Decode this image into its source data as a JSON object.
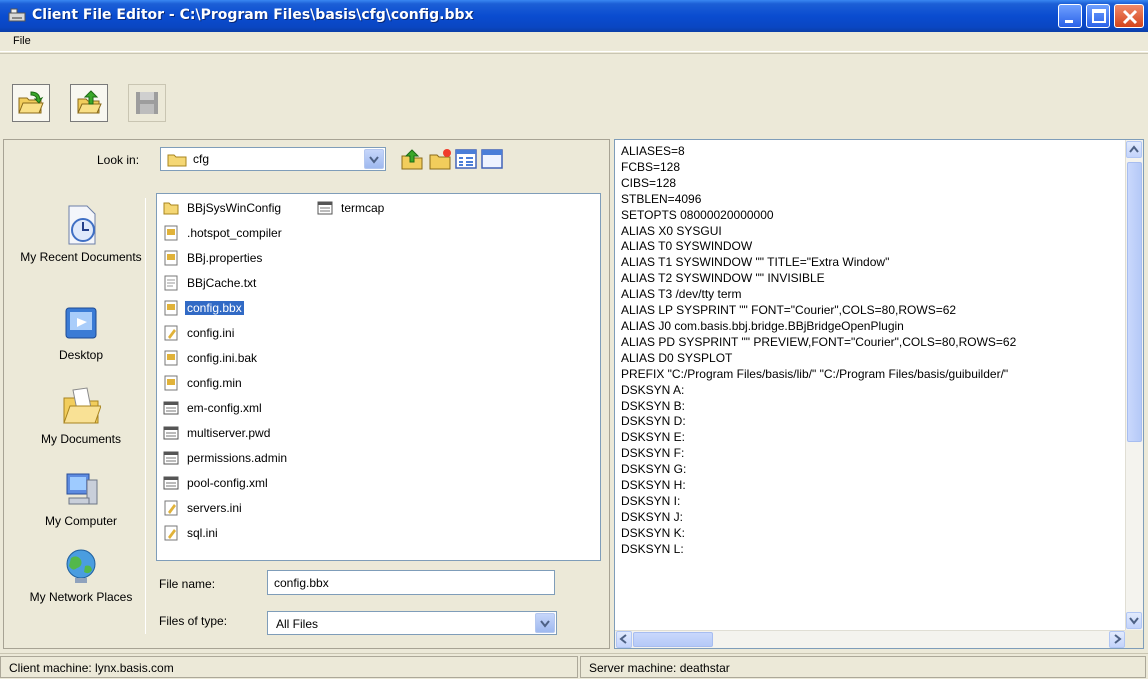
{
  "window": {
    "title": "Client File Editor - C:\\Program Files\\basis\\cfg\\config.bbx"
  },
  "menu": {
    "file_label": "File"
  },
  "toolbar": {
    "buttons": [
      "open-button",
      "open-server-button",
      "save-button"
    ]
  },
  "dialog": {
    "look_in_label": "Look in:",
    "look_in_value": "cfg",
    "places": [
      {
        "label": "My Recent Documents",
        "icon": "recent-documents-icon"
      },
      {
        "label": "Desktop",
        "icon": "desktop-icon"
      },
      {
        "label": "My Documents",
        "icon": "my-documents-icon"
      },
      {
        "label": "My Computer",
        "icon": "my-computer-icon"
      },
      {
        "label": "My Network Places",
        "icon": "network-places-icon"
      }
    ],
    "files": [
      {
        "name": "BBjSysWinConfig",
        "icon": "folder-icon"
      },
      {
        "name": ".hotspot_compiler",
        "icon": "text-file-icon"
      },
      {
        "name": "BBj.properties",
        "icon": "text-file-icon"
      },
      {
        "name": "BBjCache.txt",
        "icon": "document-icon"
      },
      {
        "name": "config.bbx",
        "icon": "text-file-icon",
        "selected": true
      },
      {
        "name": "config.ini",
        "icon": "settings-file-icon"
      },
      {
        "name": "config.ini.bak",
        "icon": "text-file-icon"
      },
      {
        "name": "config.min",
        "icon": "text-file-icon"
      },
      {
        "name": "em-config.xml",
        "icon": "xml-file-icon"
      },
      {
        "name": "multiserver.pwd",
        "icon": "xml-file-icon"
      },
      {
        "name": "permissions.admin",
        "icon": "xml-file-icon"
      },
      {
        "name": "pool-config.xml",
        "icon": "xml-file-icon"
      },
      {
        "name": "servers.ini",
        "icon": "settings-file-icon"
      },
      {
        "name": "sql.ini",
        "icon": "settings-file-icon"
      },
      {
        "name": "termcap",
        "icon": "xml-file-icon"
      }
    ],
    "file_name_label": "File name:",
    "file_name_value": "config.bbx",
    "files_of_type_label": "Files of type:",
    "files_of_type_value": "All Files"
  },
  "editor": {
    "lines": [
      "ALIASES=8",
      "FCBS=128",
      "CIBS=128",
      "STBLEN=4096",
      "SETOPTS 08000020000000",
      "ALIAS X0 SYSGUI",
      "ALIAS T0 SYSWINDOW",
      "ALIAS T1 SYSWINDOW \"\" TITLE=\"Extra Window\"",
      "ALIAS T2 SYSWINDOW \"\" INVISIBLE",
      "ALIAS T3 /dev/tty term",
      "ALIAS LP SYSPRINT \"\" FONT=\"Courier\",COLS=80,ROWS=62",
      "ALIAS J0 com.basis.bbj.bridge.BBjBridgeOpenPlugin",
      "ALIAS PD SYSPRINT \"\" PREVIEW,FONT=\"Courier\",COLS=80,ROWS=62",
      "ALIAS D0 SYSPLOT",
      "PREFIX \"C:/Program Files/basis/lib/\" \"C:/Program Files/basis/guibuilder/\"",
      "DSKSYN A:",
      "DSKSYN B:",
      "DSKSYN D:",
      "DSKSYN E:",
      "DSKSYN F:",
      "DSKSYN G:",
      "DSKSYN H:",
      "DSKSYN I:",
      "DSKSYN J:",
      "DSKSYN K:",
      "DSKSYN L:"
    ]
  },
  "status": {
    "client": "Client machine: lynx.basis.com",
    "server": "Server machine: deathstar"
  }
}
